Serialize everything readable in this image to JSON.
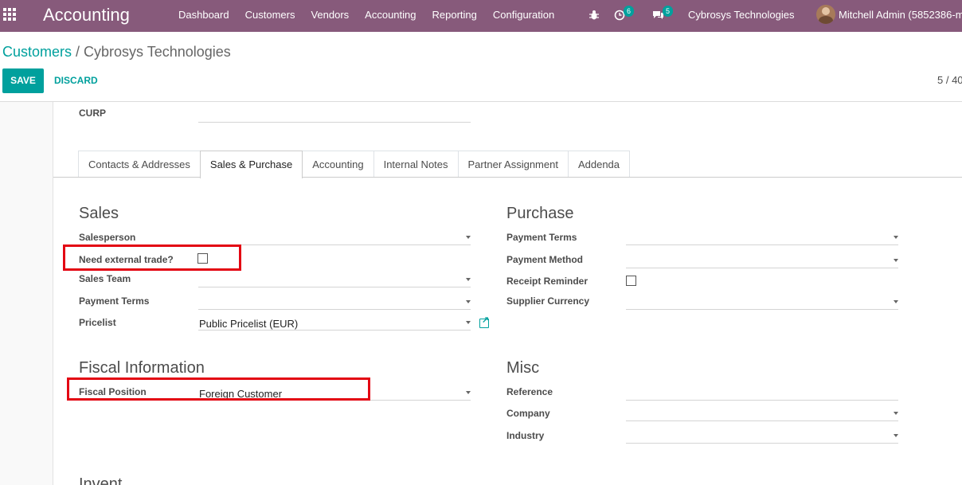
{
  "nav": {
    "brand": "Accounting",
    "menu": [
      "Dashboard",
      "Customers",
      "Vendors",
      "Accounting",
      "Reporting",
      "Configuration"
    ],
    "activity_count": "6",
    "message_count": "5",
    "company": "Cybrosys Technologies",
    "user": "Mitchell Admin (5852386-m"
  },
  "breadcrumb": {
    "parent": "Customers",
    "separator": "/",
    "current": "Cybrosys Technologies"
  },
  "actions": {
    "save": "SAVE",
    "discard": "DISCARD"
  },
  "pager": "5 / 40",
  "form": {
    "curp_label": "CURP",
    "tabs": [
      "Contacts & Addresses",
      "Sales & Purchase",
      "Accounting",
      "Internal Notes",
      "Partner Assignment",
      "Addenda"
    ],
    "active_tab": "Sales & Purchase",
    "sales": {
      "title": "Sales",
      "salesperson": "Salesperson",
      "external_trade": "Need external trade?",
      "sales_team": "Sales Team",
      "payment_terms": "Payment Terms",
      "pricelist": "Pricelist",
      "pricelist_value": "Public Pricelist (EUR)"
    },
    "purchase": {
      "title": "Purchase",
      "payment_terms": "Payment Terms",
      "payment_method": "Payment Method",
      "receipt_reminder": "Receipt Reminder",
      "supplier_currency": "Supplier Currency"
    },
    "fiscal": {
      "title": "Fiscal Information",
      "fiscal_position": "Fiscal Position",
      "fiscal_position_value": "Foreign Customer"
    },
    "misc": {
      "title": "Misc",
      "reference": "Reference",
      "company": "Company",
      "industry": "Industry"
    },
    "next_section_partial": "Invent"
  },
  "colors": {
    "nav": "#875a7b",
    "accent": "#00a09d",
    "highlight": "#e30613"
  }
}
